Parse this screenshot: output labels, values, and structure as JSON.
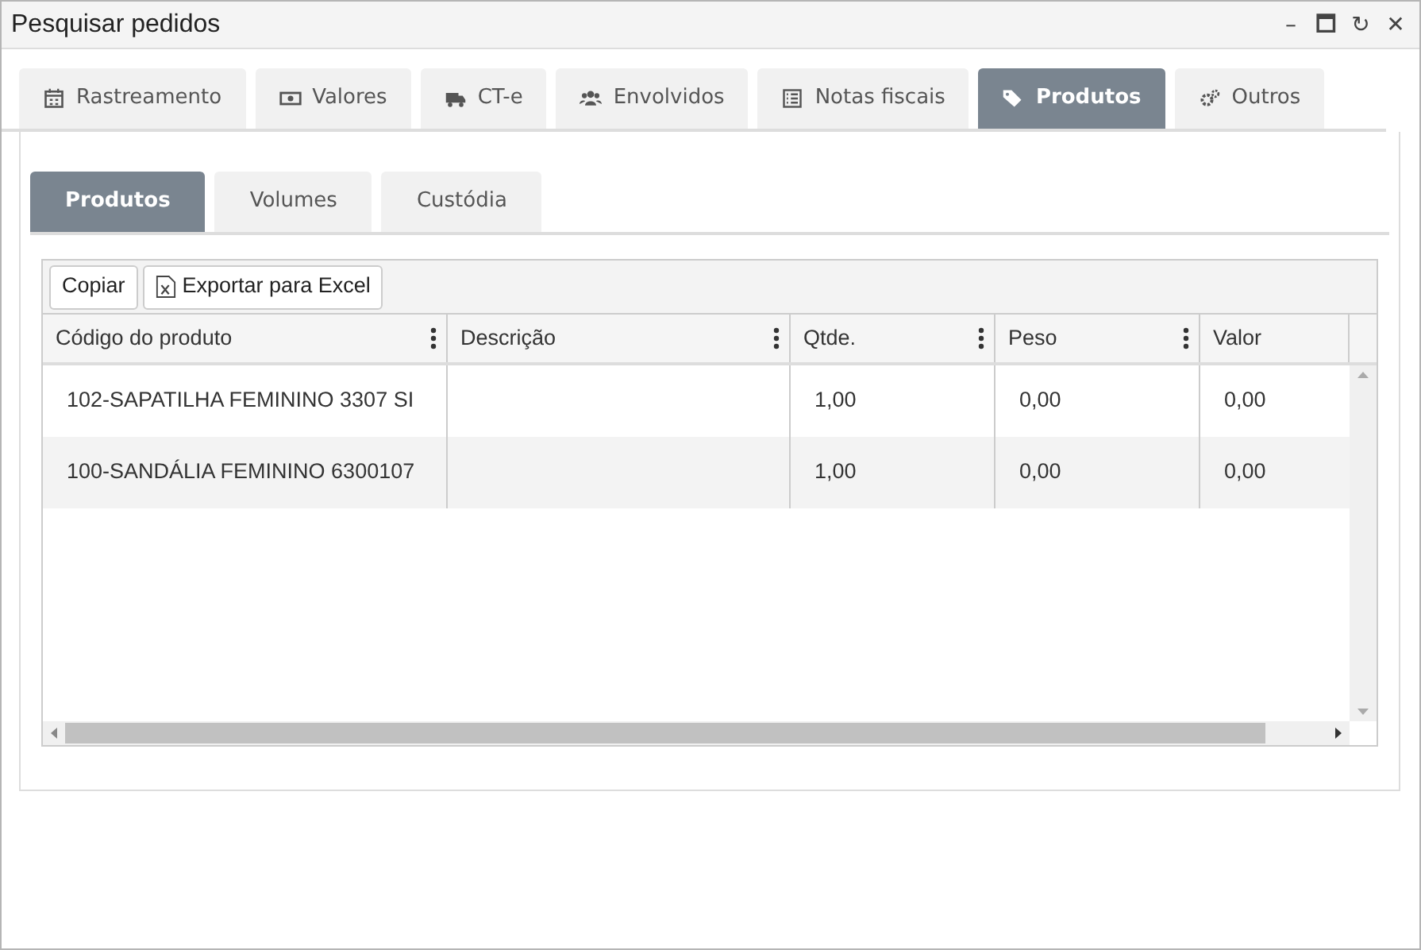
{
  "window": {
    "title": "Pesquisar pedidos",
    "controls": [
      "–",
      "🗖",
      "↻",
      "✕"
    ]
  },
  "tabs": [
    {
      "label": "Rastreamento",
      "selected": false
    },
    {
      "label": "Valores",
      "selected": false
    },
    {
      "label": "CT-e",
      "selected": false
    },
    {
      "label": "Envolvidos",
      "selected": false
    },
    {
      "label": "Notas fiscais",
      "selected": false
    },
    {
      "label": "Produtos",
      "selected": true
    },
    {
      "label": "Outros",
      "selected": false
    }
  ],
  "subtabs": [
    {
      "label": "Produtos",
      "selected": true
    },
    {
      "label": "Volumes",
      "selected": false
    },
    {
      "label": "Custódia",
      "selected": false
    }
  ],
  "toolbar": [
    {
      "label": "Copiar",
      "kind": "plain"
    },
    {
      "label": "Exportar para Excel",
      "kind": "excel"
    }
  ],
  "table": {
    "columns": [
      {
        "label": "Código do produto",
        "menu": true
      },
      {
        "label": "Descrição",
        "menu": true
      },
      {
        "label": "Qtde.",
        "menu": true
      },
      {
        "label": "Peso",
        "menu": true
      },
      {
        "label": "Valor",
        "menu": false
      }
    ],
    "rows": [
      [
        "102-SAPATILHA FEMININO 3307 SI",
        "",
        "1,00",
        "0,00",
        "0,00"
      ],
      [
        "100-SANDÁLIA FEMININO 6300107",
        "",
        "1,00",
        "0,00",
        "0,00"
      ]
    ]
  }
}
